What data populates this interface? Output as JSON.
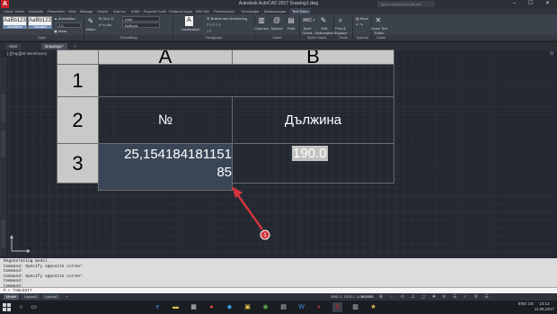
{
  "app": {
    "logo": "A",
    "title": "Autodesk AutoCAD 2017   Drawing1.dwg",
    "search_placeholder": "Type a keyword or phrase",
    "window_controls": "– ☐ ✕"
  },
  "menu_tabs": [
    {
      "label": "Home",
      "active": false
    },
    {
      "label": "Insert",
      "active": false
    },
    {
      "label": "Annotate",
      "active": false
    },
    {
      "label": "Parametric",
      "active": false
    },
    {
      "label": "View",
      "active": false
    },
    {
      "label": "Manage",
      "active": false
    },
    {
      "label": "Output",
      "active": false
    },
    {
      "label": "Add-ins",
      "active": false
    },
    {
      "label": "A360",
      "active": false
    },
    {
      "label": "Express Tools",
      "active": false
    },
    {
      "label": "Featured Apps",
      "active": false
    },
    {
      "label": "BIM 360",
      "active": false
    },
    {
      "label": "Performance",
      "active": false
    },
    {
      "label": "Топографи",
      "active": false
    },
    {
      "label": "Канализация",
      "active": false
    },
    {
      "label": "Text Editor",
      "active": true
    }
  ],
  "ribbon": {
    "style_swatch_1": {
      "sample": "AaBb123",
      "name": "Annotative"
    },
    "style_swatch_2": {
      "sample": "AaBb123",
      "name": "Standard"
    },
    "annotative_label": "Annotative",
    "text_height": "2.5",
    "mask_label": "Mask",
    "match_label": "Match",
    "font_name": "Arial",
    "color_name": "ByBlock",
    "justification_label": "Justification",
    "bullets_label": "Bullets and Numbering",
    "columns_label": "Columns",
    "symbol_label": "Symbol",
    "field_label": "Field",
    "spell_check_label": "Spell Check",
    "edit_dictionaries_label": "Edit Dictionaries",
    "find_replace_label": "Find & Replace",
    "more_label": "More",
    "close_editor_label": "Close Text Editor",
    "panels": {
      "style": "Style",
      "formatting": "Formatting",
      "paragraph": "Paragraph",
      "insert": "Insert",
      "spell_check": "Spell Check",
      "tools": "Tools",
      "options": "Options",
      "close": "Close"
    }
  },
  "doc_tabs": [
    {
      "label": "Start",
      "active": false
    },
    {
      "label": "Drawing1*",
      "active": true
    }
  ],
  "viewport": {
    "label": "[-][Top][2D Wireframe]",
    "viewcube": "N"
  },
  "table": {
    "col_headers": [
      "A",
      "B"
    ],
    "row_headers": [
      "1",
      "2",
      "3"
    ],
    "cells": {
      "a2": "№",
      "b2": "Дължина",
      "a3": "25,154184181151\n85",
      "b3": "190.0"
    }
  },
  "annotation": {
    "marker": "1"
  },
  "command": {
    "history": [
      "Regenerating model.",
      "Command: Specify opposite corner:",
      "Command:",
      "Command: Specify opposite corner:",
      "Command:",
      "Command:"
    ],
    "prompt": "TABLEDIT"
  },
  "status": {
    "layout_tabs": [
      {
        "label": "Model",
        "active": true
      },
      {
        "label": "Layout1",
        "active": false
      },
      {
        "label": "Layout2",
        "active": false
      }
    ],
    "coords": "3981.2, 1575.1, 0.0",
    "model_label": "MODEL"
  },
  "taskbar": {
    "lang": "ENG US",
    "time": "10:13",
    "date": "11.05.2017"
  },
  "colors": {
    "drawing_bg": "#232831",
    "table_header": "#c9c9c9",
    "selection": "#3a4656",
    "annotation": "#d2343c"
  }
}
